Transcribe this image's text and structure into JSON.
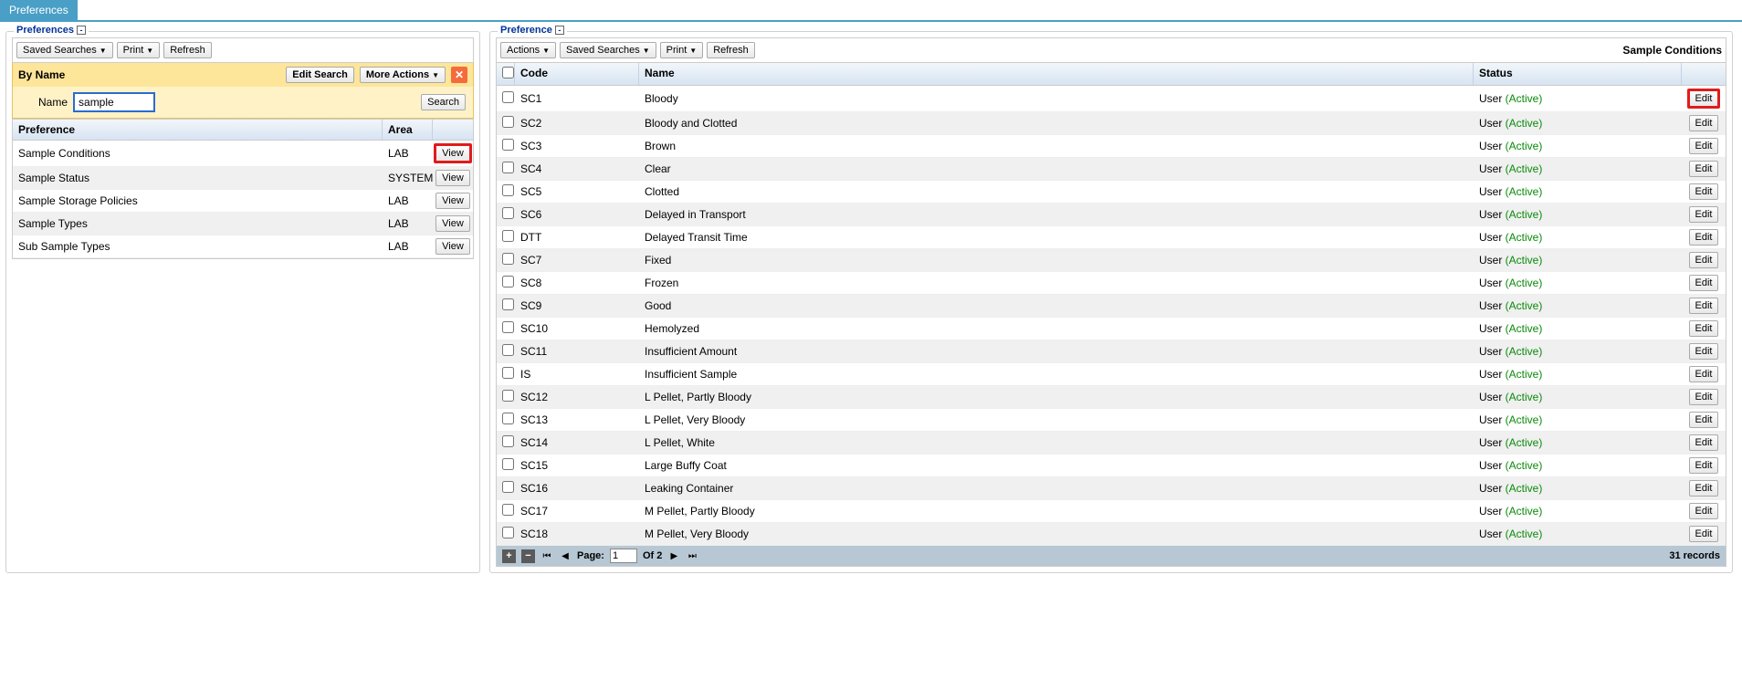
{
  "tabs": {
    "preferences": "Preferences"
  },
  "left": {
    "title": "Preferences",
    "toolbar": {
      "saved_searches": "Saved Searches",
      "print": "Print",
      "refresh": "Refresh"
    },
    "search": {
      "by_name": "By Name",
      "edit_search": "Edit Search",
      "more_actions": "More Actions",
      "name_label": "Name",
      "name_value": "sample ",
      "search_btn": "Search"
    },
    "headers": {
      "preference": "Preference",
      "area": "Area"
    },
    "view_btn": "View",
    "rows": [
      {
        "pref": "Sample Conditions",
        "area": "LAB",
        "hl": true
      },
      {
        "pref": "Sample Status",
        "area": "SYSTEM",
        "hl": false
      },
      {
        "pref": "Sample Storage Policies",
        "area": "LAB",
        "hl": false
      },
      {
        "pref": "Sample Types",
        "area": "LAB",
        "hl": false
      },
      {
        "pref": "Sub Sample Types",
        "area": "LAB",
        "hl": false
      }
    ]
  },
  "right": {
    "title": "Preference",
    "toolbar": {
      "actions": "Actions",
      "saved_searches": "Saved Searches",
      "print": "Print",
      "refresh": "Refresh"
    },
    "label": "Sample Conditions",
    "headers": {
      "code": "Code",
      "name": "Name",
      "status": "Status"
    },
    "status_user": "User",
    "status_active": "(Active)",
    "edit_btn": "Edit",
    "rows": [
      {
        "code": "SC1",
        "name": "Bloody",
        "hl": true
      },
      {
        "code": "SC2",
        "name": "Bloody and Clotted",
        "hl": false
      },
      {
        "code": "SC3",
        "name": "Brown",
        "hl": false
      },
      {
        "code": "SC4",
        "name": "Clear",
        "hl": false
      },
      {
        "code": "SC5",
        "name": "Clotted",
        "hl": false
      },
      {
        "code": "SC6",
        "name": "Delayed in Transport",
        "hl": false
      },
      {
        "code": "DTT",
        "name": "Delayed Transit Time",
        "hl": false
      },
      {
        "code": "SC7",
        "name": "Fixed",
        "hl": false
      },
      {
        "code": "SC8",
        "name": "Frozen",
        "hl": false
      },
      {
        "code": "SC9",
        "name": "Good",
        "hl": false
      },
      {
        "code": "SC10",
        "name": "Hemolyzed",
        "hl": false
      },
      {
        "code": "SC11",
        "name": "Insufficient Amount",
        "hl": false
      },
      {
        "code": "IS",
        "name": "Insufficient Sample",
        "hl": false
      },
      {
        "code": "SC12",
        "name": "L Pellet, Partly Bloody",
        "hl": false
      },
      {
        "code": "SC13",
        "name": "L Pellet, Very Bloody",
        "hl": false
      },
      {
        "code": "SC14",
        "name": "L Pellet, White",
        "hl": false
      },
      {
        "code": "SC15",
        "name": "Large Buffy Coat",
        "hl": false
      },
      {
        "code": "SC16",
        "name": "Leaking Container",
        "hl": false
      },
      {
        "code": "SC17",
        "name": "M Pellet, Partly Bloody",
        "hl": false
      },
      {
        "code": "SC18",
        "name": "M Pellet, Very Bloody",
        "hl": false
      }
    ],
    "pager": {
      "page_label": "Page:",
      "page_value": "1",
      "of_label": "Of 2",
      "records": "31 records"
    }
  }
}
